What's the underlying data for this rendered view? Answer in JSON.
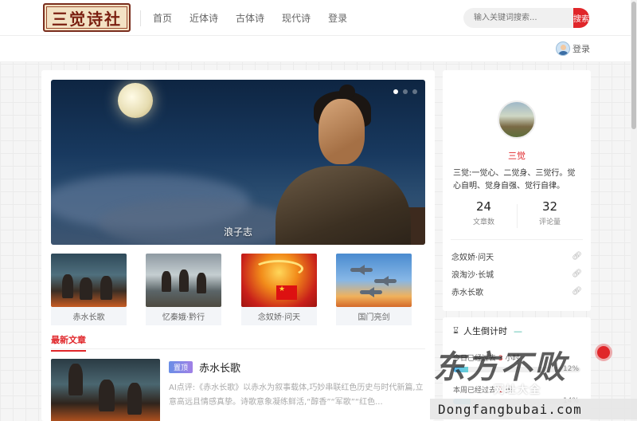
{
  "header": {
    "logo_text": "三觉诗社",
    "nav": [
      "首页",
      "近体诗",
      "古体诗",
      "现代诗",
      "登录"
    ],
    "search_placeholder": "输入关键词搜索...",
    "search_button": "搜索"
  },
  "subbar": {
    "login_label": "登录"
  },
  "hero": {
    "caption": "浪子志",
    "slides": 3,
    "active_slide": 1
  },
  "thumbnails": [
    {
      "label": "赤水长歌"
    },
    {
      "label": "忆秦娥·黔行"
    },
    {
      "label": "念奴娇·问天"
    },
    {
      "label": "国门亮剑"
    }
  ],
  "latest": {
    "tab_label": "最新文章",
    "articles": [
      {
        "badge": "置顶",
        "title": "赤水长歌",
        "excerpt": "AI点评:《赤水长歌》以赤水为叙事载体,巧妙串联红色历史与时代新篇,立意高远且情感真挚。诗歌意象凝练鲜活,“醇香”“军歌”“红色..."
      }
    ]
  },
  "profile": {
    "name": "三觉",
    "bio": "三觉:一觉心、二觉身、三觉行。觉心自明、觉身自强、觉行自律。",
    "stats": [
      {
        "value": "24",
        "label": "文章数"
      },
      {
        "value": "32",
        "label": "评论量"
      }
    ],
    "links": [
      "念奴娇·问天",
      "浪淘沙·长城",
      "赤水长歌"
    ]
  },
  "countdown": {
    "title": "人生倒计时",
    "rows": [
      {
        "text_prefix": "今日已经过去",
        "value": "3",
        "unit": "小时",
        "percent_label": "12%",
        "fraction": 0.12
      },
      {
        "text_prefix": "本周已经过去",
        "value": "1",
        "unit": "天",
        "percent_label": "14%",
        "fraction": 0.14
      }
    ]
  },
  "watermark": {
    "brand": "东方不败",
    "sub": [
      "网",
      "址",
      "大",
      "全"
    ],
    "url": "Dongfangbubai.com"
  },
  "colors": {
    "accent": "#e0262a",
    "logo_border": "#7a2e1e",
    "bar": "#5bb6f0"
  },
  "icons": [
    "search-icon",
    "user-avatar-icon",
    "link-icon",
    "hourglass-icon"
  ]
}
